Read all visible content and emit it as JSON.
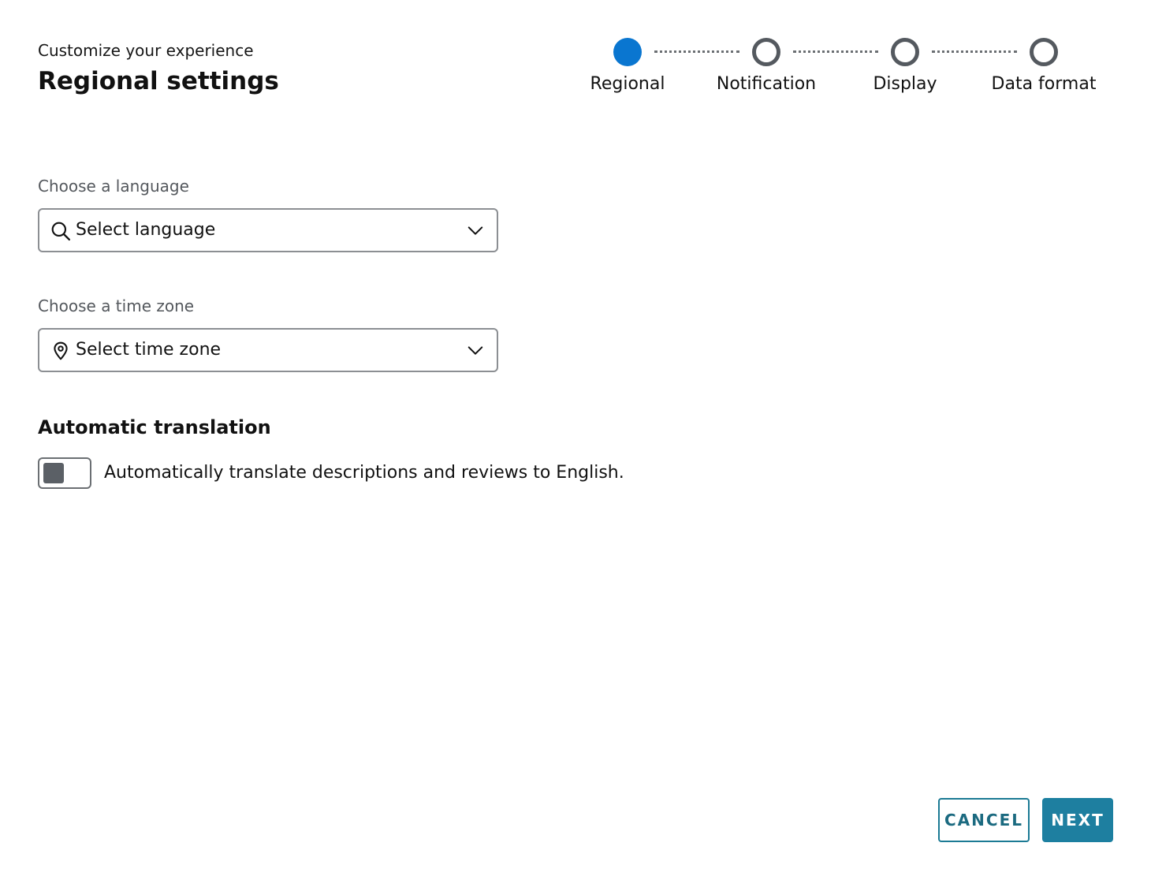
{
  "header": {
    "subtitle": "Customize your experience",
    "title": "Regional settings"
  },
  "stepper": {
    "steps": [
      {
        "label": "Regional",
        "state": "active"
      },
      {
        "label": "Notification",
        "state": "pending"
      },
      {
        "label": "Display",
        "state": "pending"
      },
      {
        "label": "Data format",
        "state": "pending"
      }
    ]
  },
  "language": {
    "label": "Choose a language",
    "placeholder": "Select language",
    "icon": "search-icon"
  },
  "timezone": {
    "label": "Choose a time zone",
    "placeholder": "Select time zone",
    "icon": "location-pin-icon"
  },
  "translation": {
    "title": "Automatic translation",
    "toggle_text": "Automatically translate descriptions and reviews to English.",
    "enabled": false
  },
  "actions": {
    "cancel_label": "CANCEL",
    "next_label": "NEXT"
  },
  "colors": {
    "active_step": "#0a76d0",
    "pending_step": "#54595f",
    "primary_button": "#1e7fa0"
  }
}
